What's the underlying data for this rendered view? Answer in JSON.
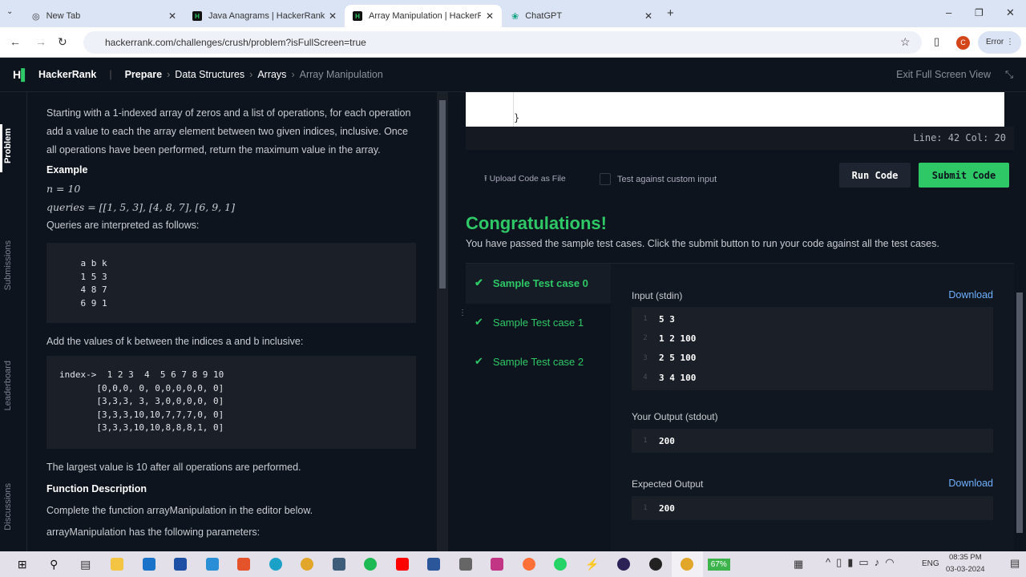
{
  "browser": {
    "tabs": [
      {
        "label": "New Tab"
      },
      {
        "label": "Java Anagrams | HackerRank"
      },
      {
        "label": "Array Manipulation | HackerRank",
        "active": true
      },
      {
        "label": "ChatGPT"
      }
    ],
    "url": "hackerrank.com/challenges/crush/problem?isFullScreen=true",
    "profile": "C",
    "error_label": "Error"
  },
  "header": {
    "brand": "HackerRank",
    "breadcrumbs": [
      "Prepare",
      "Data Structures",
      "Arrays",
      "Array Manipulation"
    ],
    "exit_label": "Exit Full Screen View"
  },
  "side_tabs": [
    "Problem",
    "Submissions",
    "Leaderboard",
    "Discussions"
  ],
  "problem": {
    "intro": "Starting with a 1-indexed array of zeros and a list of operations, for each operation add a value to each the array element between two given indices, inclusive. Once all operations have been performed, return the maximum value in the array.",
    "example_heading": "Example",
    "n_line": "n = 10",
    "queries_line": "queries = [[1, 5, 3], [4, 8, 7], [6, 9, 1]",
    "interp": "Queries are interpreted as follows:",
    "code1": "    a b k\n    1 5 3\n    4 8 7\n    6 9 1",
    "add_text": "Add the values of k between the indices a and b inclusive:",
    "code2": "index->  1 2 3  4  5 6 7 8 9 10\n\t[0,0,0, 0, 0,0,0,0,0, 0]\n\t[3,3,3, 3, 3,0,0,0,0, 0]\n\t[3,3,3,10,10,7,7,7,0, 0]\n\t[3,3,3,10,10,8,8,8,1, 0]",
    "largest": "The largest value is 10 after all operations are performed.",
    "fd_heading": "Function Description",
    "fd_text": "Complete the function arrayManipulation in the editor below.",
    "params_text": "arrayManipulation has the following parameters:"
  },
  "editor": {
    "closing_brace": "}",
    "status": "Line: 42 Col: 20",
    "upload_label": "Upload Code as File",
    "custom_input_label": "Test against custom input",
    "run_label": "Run Code",
    "submit_label": "Submit Code"
  },
  "result": {
    "title": "Congratulations!",
    "message": "You have passed the sample test cases. Click the submit button to run your code against all the test cases.",
    "cases": [
      "Sample Test case 0",
      "Sample Test case 1",
      "Sample Test case 2"
    ],
    "input_label": "Input (stdin)",
    "download_label": "Download",
    "input_lines": [
      "5 3",
      "1 2 100",
      "2 5 100",
      "3 4 100"
    ],
    "output_label": "Your Output (stdout)",
    "output_lines": [
      "200"
    ],
    "expected_label": "Expected Output",
    "expected_lines": [
      "200"
    ]
  },
  "taskbar": {
    "battery": "67%",
    "lang": "ENG",
    "time": "08:35 PM",
    "date": "03-03-2024"
  },
  "colors": {
    "accent": "#2ec866",
    "bg": "#0e141e"
  }
}
